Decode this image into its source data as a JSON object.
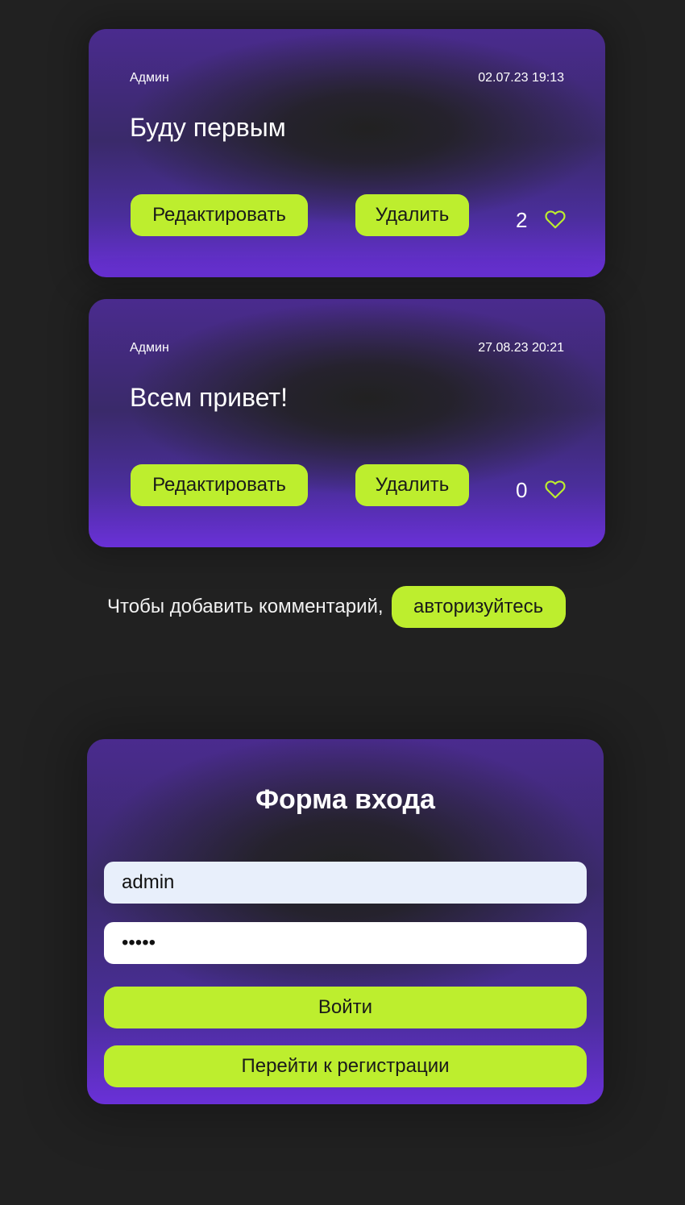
{
  "comments": [
    {
      "author": "Админ",
      "date": "02.07.23 19:13",
      "text": "Буду первым",
      "edit_label": "Редактировать",
      "delete_label": "Удалить",
      "likes": "2"
    },
    {
      "author": "Админ",
      "date": "27.08.23 20:21",
      "text": "Всем привет!",
      "edit_label": "Редактировать",
      "delete_label": "Удалить",
      "likes": "0"
    }
  ],
  "auth_prompt": {
    "text": "Чтобы добавить комментарий,",
    "button_label": "авторизуйтесь"
  },
  "login_form": {
    "title": "Форма входа",
    "username_value": "admin",
    "password_value": "12345",
    "submit_label": "Войти",
    "register_label": "Перейти к регистрации"
  },
  "colors": {
    "background": "#212121",
    "accent": "#bdee2e",
    "card_purple": "#6a30d8"
  },
  "icons": {
    "like": "heart-icon"
  }
}
